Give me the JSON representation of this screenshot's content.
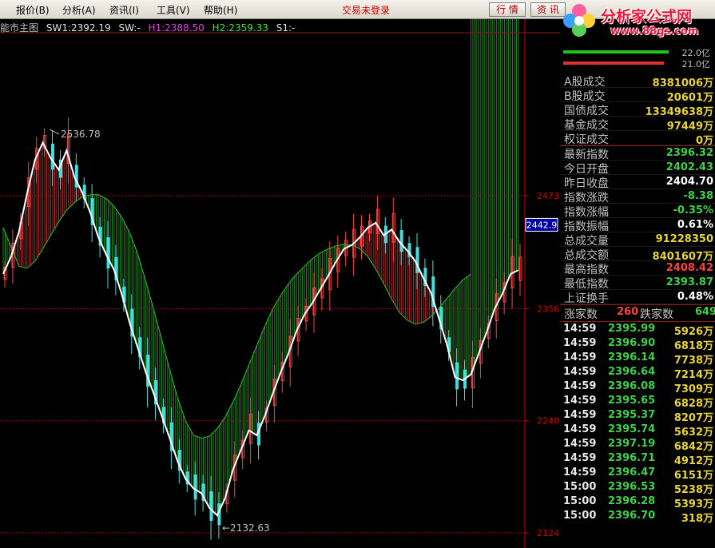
{
  "menu": {
    "items": [
      "报价(B)",
      "分析(A)",
      "资讯(I)",
      "工具(V)",
      "帮助(H)"
    ],
    "status": "交易未登录",
    "quote_button": "行 情",
    "info_button": "资 讯"
  },
  "logo": {
    "brand": "分析家公式网",
    "url": "www.88gs.com"
  },
  "chart": {
    "title": "能市主图",
    "sw1": "SW1:2392.19",
    "sw": "SW:-",
    "h1": "H1:2388.50",
    "h2": "H2:2359.33",
    "s1": "S1:-",
    "high_label": "2536.78",
    "low_label": "←2132.63",
    "axis_ticks": [
      "2473",
      "2356",
      "2240",
      "2124"
    ],
    "current_price": "2442.9",
    "colors": {
      "up": "#ff4040",
      "down": "#40e0e0",
      "band": "#30c030",
      "line": "#ffffff",
      "axis": "#d00000"
    }
  },
  "chart_data": {
    "type": "line",
    "ylim": [
      2124,
      2540
    ],
    "series": [
      {
        "values": [
          2392,
          2410,
          2436,
          2475,
          2510,
          2528,
          2512,
          2500,
          2520,
          2492,
          2476,
          2455,
          2430,
          2412,
          2396,
          2370,
          2340,
          2315,
          2290,
          2268,
          2245,
          2222,
          2198,
          2180,
          2170,
          2165,
          2150,
          2142,
          2160,
          2190,
          2210,
          2230,
          2225,
          2245,
          2268,
          2290,
          2310,
          2333,
          2350,
          2362,
          2376,
          2390,
          2405,
          2418,
          2422,
          2430,
          2440,
          2445,
          2432,
          2438,
          2425,
          2416,
          2405,
          2388,
          2372,
          2345,
          2318,
          2285,
          2282,
          2288,
          2310,
          2332,
          2356,
          2372,
          2392,
          2396
        ]
      },
      {
        "values": [
          2440,
          2420,
          2400,
          2398,
          2405,
          2418,
          2432,
          2446,
          2458,
          2466,
          2472,
          2474,
          2474,
          2470,
          2462,
          2450,
          2434,
          2412,
          2384,
          2355,
          2324,
          2293,
          2264,
          2240,
          2225,
          2222,
          2224,
          2232,
          2244,
          2260,
          2278,
          2298,
          2318,
          2338,
          2356,
          2370,
          2382,
          2392,
          2400,
          2408,
          2414,
          2418,
          2421,
          2423,
          2422,
          2418,
          2410,
          2397,
          2382,
          2366,
          2352,
          2344,
          2340,
          2342,
          2348,
          2357,
          2367,
          2377,
          2386,
          2392
        ]
      }
    ]
  },
  "panel": {
    "vol_top": "22.0亿",
    "vol_bottom": "21.0亿",
    "stats": [
      {
        "label": "A股成交",
        "value": "8381006万",
        "color": "#e8d43a"
      },
      {
        "label": "B股成交",
        "value": "20601万",
        "color": "#e8d43a"
      },
      {
        "label": "国债成交",
        "value": "13349638万",
        "color": "#e8d43a"
      },
      {
        "label": "基金成交",
        "value": "97449万",
        "color": "#e8d43a"
      },
      {
        "label": "权证成交",
        "value": "0万",
        "color": "#e8d43a"
      },
      {
        "label": "最新指数",
        "value": "2396.32",
        "color": "#3ed048"
      },
      {
        "label": "今日开盘",
        "value": "2402.43",
        "color": "#3ed048"
      },
      {
        "label": "昨日收盘",
        "value": "2404.70",
        "color": "#ffffff"
      },
      {
        "label": "指数涨跌",
        "value": "-8.38",
        "color": "#3ed048"
      },
      {
        "label": "指数涨幅",
        "value": "-0.35%",
        "color": "#3ed048"
      },
      {
        "label": "指数振幅",
        "value": "0.61%",
        "color": "#ffffff"
      },
      {
        "label": "总成交量",
        "value": "91228350",
        "color": "#e8d43a"
      },
      {
        "label": "总成交额",
        "value": "8401607万",
        "color": "#e8d43a"
      },
      {
        "label": "最高指数",
        "value": "2408.42",
        "color": "#ff4040"
      },
      {
        "label": "最低指数",
        "value": "2393.87",
        "color": "#3ed048"
      },
      {
        "label": "上证换手",
        "value": "0.48%",
        "color": "#ffffff"
      }
    ],
    "up_label": "涨家数",
    "up_count": "260",
    "down_label": "跌家数",
    "down_count": "649",
    "ticks": [
      {
        "time": "14:59",
        "price": "2395.99",
        "vol": "5926万"
      },
      {
        "time": "14:59",
        "price": "2396.90",
        "vol": "6818万"
      },
      {
        "time": "14:59",
        "price": "2396.14",
        "vol": "7738万"
      },
      {
        "time": "14:59",
        "price": "2396.64",
        "vol": "7214万"
      },
      {
        "time": "14:59",
        "price": "2396.08",
        "vol": "7309万"
      },
      {
        "time": "14:59",
        "price": "2395.65",
        "vol": "6828万"
      },
      {
        "time": "14:59",
        "price": "2395.37",
        "vol": "8207万"
      },
      {
        "time": "14:59",
        "price": "2395.74",
        "vol": "5632万"
      },
      {
        "time": "14:59",
        "price": "2397.19",
        "vol": "6842万"
      },
      {
        "time": "14:59",
        "price": "2396.71",
        "vol": "4912万"
      },
      {
        "time": "14:59",
        "price": "2396.47",
        "vol": "6151万"
      },
      {
        "time": "15:00",
        "price": "2396.53",
        "vol": "5238万"
      },
      {
        "time": "15:00",
        "price": "2396.28",
        "vol": "5393万"
      },
      {
        "time": "15:00",
        "price": "2396.70",
        "vol": "318万"
      }
    ]
  }
}
